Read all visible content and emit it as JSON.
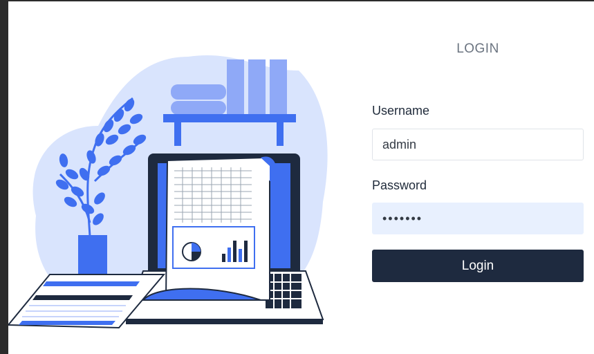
{
  "login": {
    "title": "LOGIN",
    "username_label": "Username",
    "username_value": "admin",
    "password_label": "Password",
    "password_value": "•••••••",
    "submit_label": "Login"
  },
  "colors": {
    "accent": "#3f6ff0",
    "button_bg": "#1e2a3f",
    "blob": "#d9e4fd",
    "password_bg": "#e8f0fe"
  },
  "illustration": {
    "icon_name": "office-desk-illustration"
  }
}
